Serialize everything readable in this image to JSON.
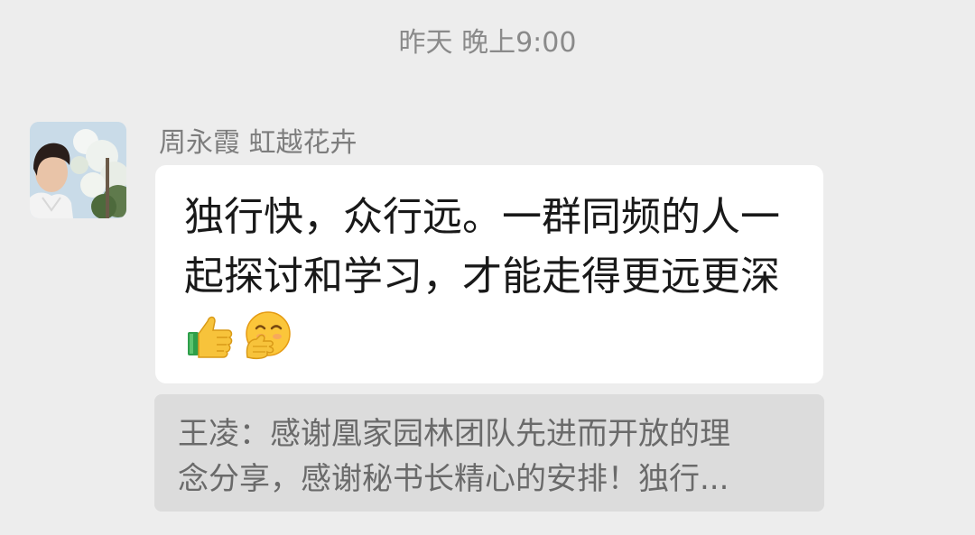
{
  "timestamp": "昨天 晚上9:00",
  "message": {
    "sender_name": "周永霞 虹越花卉",
    "text_lines": [
      "独行快，众行远。一群同频的人一",
      "起探讨和学习，才能走得更远更深"
    ],
    "emojis": [
      "thumbs-up-icon",
      "shushing-face-icon"
    ]
  },
  "quoted_reply": {
    "lines": [
      "王凌：感谢凰家园林团队先进而开放的理",
      "念分享，感谢秘书长精心的安排！独行..."
    ]
  },
  "colors": {
    "background": "#ededed",
    "bubble": "#ffffff",
    "quote_bubble": "#dcdcdc",
    "timestamp_text": "#8a8a8a",
    "sender_text": "#7d7d7d",
    "message_text": "#191919",
    "quote_text": "#6a6a6a"
  }
}
